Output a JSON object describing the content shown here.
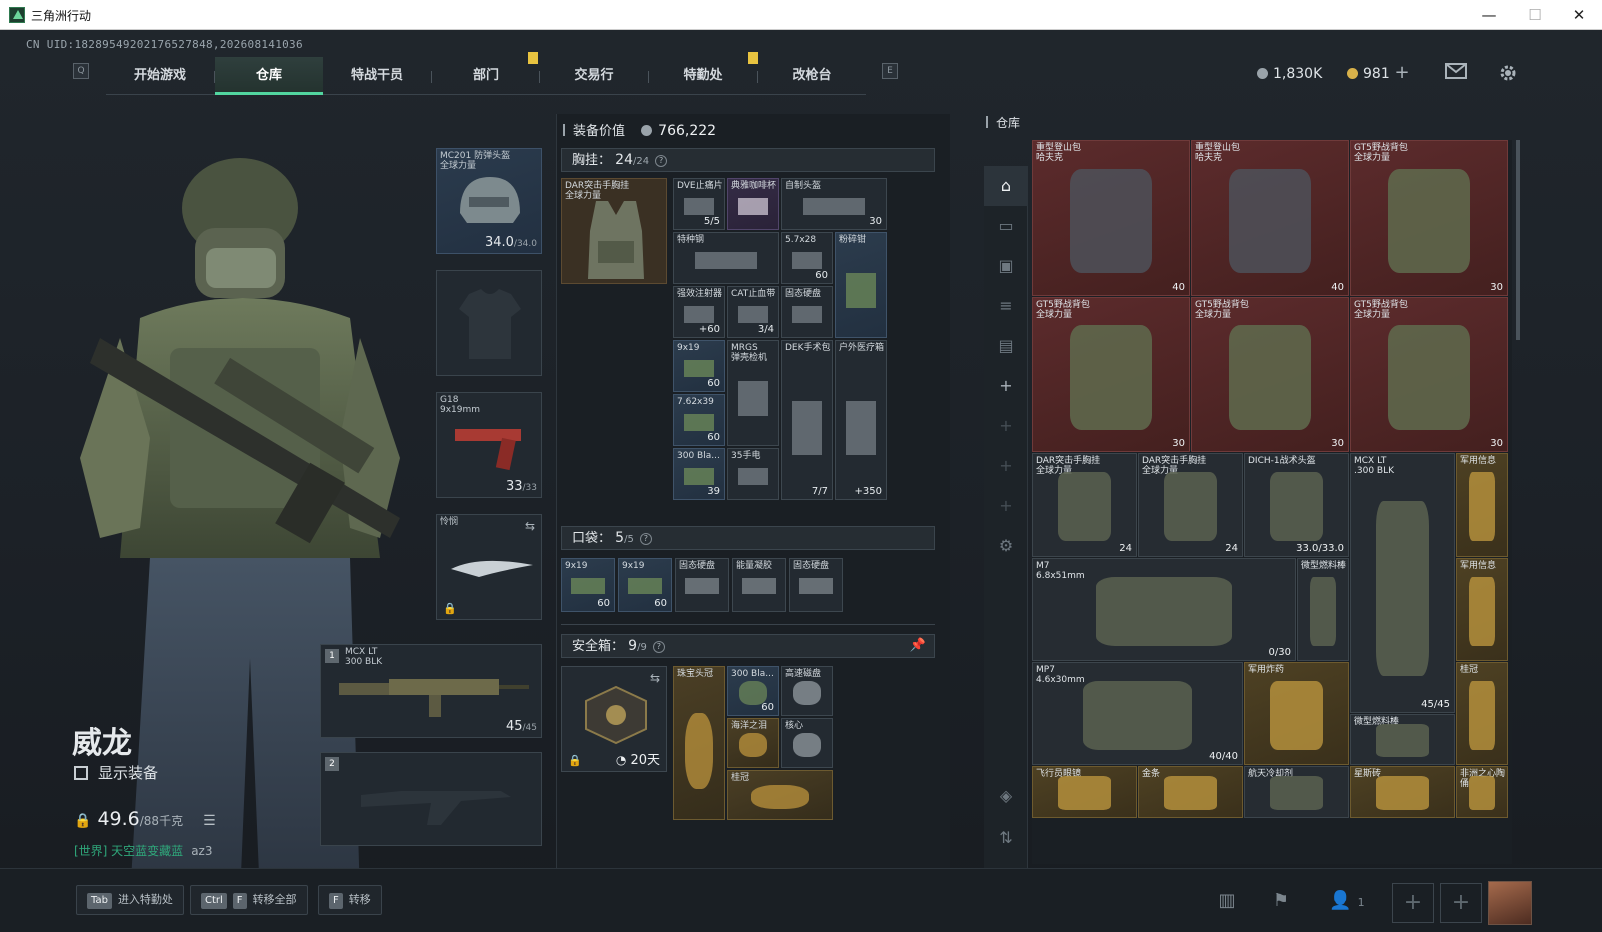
{
  "window": {
    "title": "三角洲行动",
    "minimize": "—",
    "maximize": "☐",
    "close": "✕"
  },
  "uid": "CN UID:18289549202176527848,202608141036",
  "nav": {
    "key_left": "Q",
    "key_right": "E",
    "tabs": [
      "开始游戏",
      "仓库",
      "特战干员",
      "部门",
      "交易行",
      "特勤处",
      "改枪台"
    ],
    "active": "仓库"
  },
  "currency": {
    "havoc": "1,830K",
    "coin": "981",
    "plus": "+",
    "colors": {
      "silver": "#9aa3aa",
      "gold": "#d8b14a"
    }
  },
  "operator": {
    "name": "威龙",
    "show_gear": "显示装备",
    "weight_value": "49.6",
    "weight_max": "/88千克",
    "chat_channel": "[世界] 天空蓝变藏蓝",
    "chat_user": "az3"
  },
  "slots": {
    "helmet": {
      "label": "MC201 防弹头盔",
      "sub": "全球力量",
      "value": "34.0",
      "max": "/34.0"
    },
    "pistol": {
      "label": "G18",
      "sub": "9x19mm",
      "value": "33",
      "max": "/33"
    },
    "melee": {
      "label": "怜悯"
    },
    "primary1": {
      "num": "1",
      "label": "MCX LT",
      "sub": "300 BLK",
      "value": "45",
      "max": "/45"
    },
    "primary2": {
      "num": "2"
    }
  },
  "center": {
    "equip_value_label": "装备价值",
    "equip_value": "766,222",
    "chest_label": "胸挂",
    "chest_count": "24",
    "chest_max": "/24",
    "chest_rig": {
      "label": "DAR突击手胸挂",
      "sub": "全球力量"
    },
    "chest_items": [
      {
        "label": "DVE止痛片",
        "cnt": "5/5",
        "tone": "gray"
      },
      {
        "label": "典雅咖啡杯",
        "cnt": "",
        "tone": "purple"
      },
      {
        "label": "自制头盔",
        "cnt": "30",
        "tone": "gray"
      },
      {
        "label": "特种钢",
        "cnt": "",
        "tone": "gray"
      },
      {
        "label": "5.7x28",
        "cnt": "60",
        "tone": "gray"
      },
      {
        "label": "粉碎钳",
        "cnt": "",
        "tone": "blue"
      },
      {
        "label": "强效注射器",
        "cnt": "+60",
        "tone": "gray"
      },
      {
        "label": "CAT止血带",
        "cnt": "3/4",
        "tone": "gray"
      },
      {
        "label": "固态硬盘",
        "cnt": "",
        "tone": "gray"
      },
      {
        "label": "9x19",
        "cnt": "60",
        "tone": "blue"
      },
      {
        "label": "MRGS",
        "sub": "弹壳检机",
        "cnt": "",
        "tone": "gray"
      },
      {
        "label": "DEK手术包",
        "cnt": "7/7",
        "tone": "gray"
      },
      {
        "label": "户外医疗箱",
        "cnt": "+350",
        "tone": "gray"
      },
      {
        "label": "7.62x39",
        "cnt": "60",
        "tone": "blue"
      },
      {
        "label": "300 Bla...",
        "cnt": "39",
        "tone": "blue"
      },
      {
        "label": "35手电",
        "cnt": "",
        "tone": "gray"
      }
    ],
    "pocket_label": "口袋",
    "pocket_count": "5",
    "pocket_max": "/5",
    "pocket_items": [
      {
        "label": "9x19",
        "cnt": "60",
        "tone": "blue"
      },
      {
        "label": "9x19",
        "cnt": "60",
        "tone": "blue"
      },
      {
        "label": "固态硬盘",
        "cnt": "",
        "tone": "gray"
      },
      {
        "label": "能量凝胶",
        "cnt": "",
        "tone": "gray"
      },
      {
        "label": "固态硬盘",
        "cnt": "",
        "tone": "gray"
      }
    ],
    "safe_label": "安全箱",
    "safe_count": "9",
    "safe_max": "/9",
    "safe_timer": "20天",
    "safe_items": [
      {
        "label": "珠宝头冠",
        "cnt": "",
        "tone": "gold"
      },
      {
        "label": "300 Bla...",
        "cnt": "60",
        "tone": "blue"
      },
      {
        "label": "高速磁盘",
        "cnt": "",
        "tone": "gray"
      },
      {
        "label": "海洋之泪",
        "cnt": "",
        "tone": "gold"
      },
      {
        "label": "核心",
        "cnt": "",
        "tone": "gray"
      },
      {
        "label": "桂冠",
        "cnt": "",
        "tone": "gold"
      }
    ]
  },
  "warehouse": {
    "title": "仓库",
    "items": [
      {
        "label": "重型登山包",
        "sub": "哈夫克",
        "cnt": "40",
        "tone": "red"
      },
      {
        "label": "重型登山包",
        "sub": "哈夫克",
        "cnt": "40",
        "tone": "red"
      },
      {
        "label": "GT5野战背包",
        "sub": "全球力量",
        "cnt": "30",
        "tone": "red"
      },
      {
        "label": "GT5野战背包",
        "sub": "全球力量",
        "cnt": "30",
        "tone": "red"
      },
      {
        "label": "GT5野战背包",
        "sub": "全球力量",
        "cnt": "30",
        "tone": "red"
      },
      {
        "label": "GT5野战背包",
        "sub": "全球力量",
        "cnt": "30",
        "tone": "red"
      },
      {
        "label": "DAR突击手胸挂",
        "sub": "全球力量",
        "cnt": "24",
        "tone": "gray"
      },
      {
        "label": "DAR突击手胸挂",
        "sub": "全球力量",
        "cnt": "24",
        "tone": "gray"
      },
      {
        "label": "DICH-1战术头盔",
        "sub": "",
        "cnt": "33.0/33.0",
        "tone": "gray"
      },
      {
        "label": "MCX LT",
        "sub": ".300 BLK",
        "cnt": "45/45",
        "tone": "gray"
      },
      {
        "label": "军用信息",
        "sub": "",
        "cnt": "",
        "tone": "gold"
      },
      {
        "label": "M7",
        "sub": "6.8x51mm",
        "cnt": "0/30",
        "tone": "gray"
      },
      {
        "label": "微型燃料棒",
        "sub": "",
        "cnt": "",
        "tone": "gray"
      },
      {
        "label": "军用信息",
        "sub": "",
        "cnt": "",
        "tone": "gold"
      },
      {
        "label": "MP7",
        "sub": "4.6x30mm",
        "cnt": "40/40",
        "tone": "gray"
      },
      {
        "label": "军用炸药",
        "sub": "",
        "cnt": "",
        "tone": "gold"
      },
      {
        "label": "微型燃料棒",
        "sub": "",
        "cnt": "",
        "tone": "gray"
      },
      {
        "label": "桂冠",
        "sub": "",
        "cnt": "",
        "tone": "gold"
      },
      {
        "label": "飞行员眼镜",
        "sub": "",
        "cnt": "",
        "tone": "gold"
      },
      {
        "label": "金条",
        "sub": "",
        "cnt": "",
        "tone": "gold"
      },
      {
        "label": "航天冷却剂",
        "sub": "",
        "cnt": "",
        "tone": "gray"
      },
      {
        "label": "星斯砖",
        "sub": "",
        "cnt": "",
        "tone": "gold"
      },
      {
        "label": "非洲之心陶俑",
        "sub": "",
        "cnt": "",
        "tone": "gold"
      }
    ]
  },
  "rail": [
    "home-icon",
    "weapon-icon",
    "armor-icon",
    "ammo-icon",
    "case-icon",
    "plus-icon",
    "plus-icon",
    "plus-icon",
    "plus-icon",
    "gear-icon",
    "layers-icon",
    "sort-icon"
  ],
  "bottom": {
    "hints": [
      {
        "keys": [
          "Tab"
        ],
        "label": "进入特勤处"
      },
      {
        "keys": [
          "Ctrl",
          "F"
        ],
        "label": "转移全部"
      },
      {
        "keys": [
          "F"
        ],
        "label": "转移"
      }
    ],
    "squad_count": "1",
    "add": "+"
  }
}
